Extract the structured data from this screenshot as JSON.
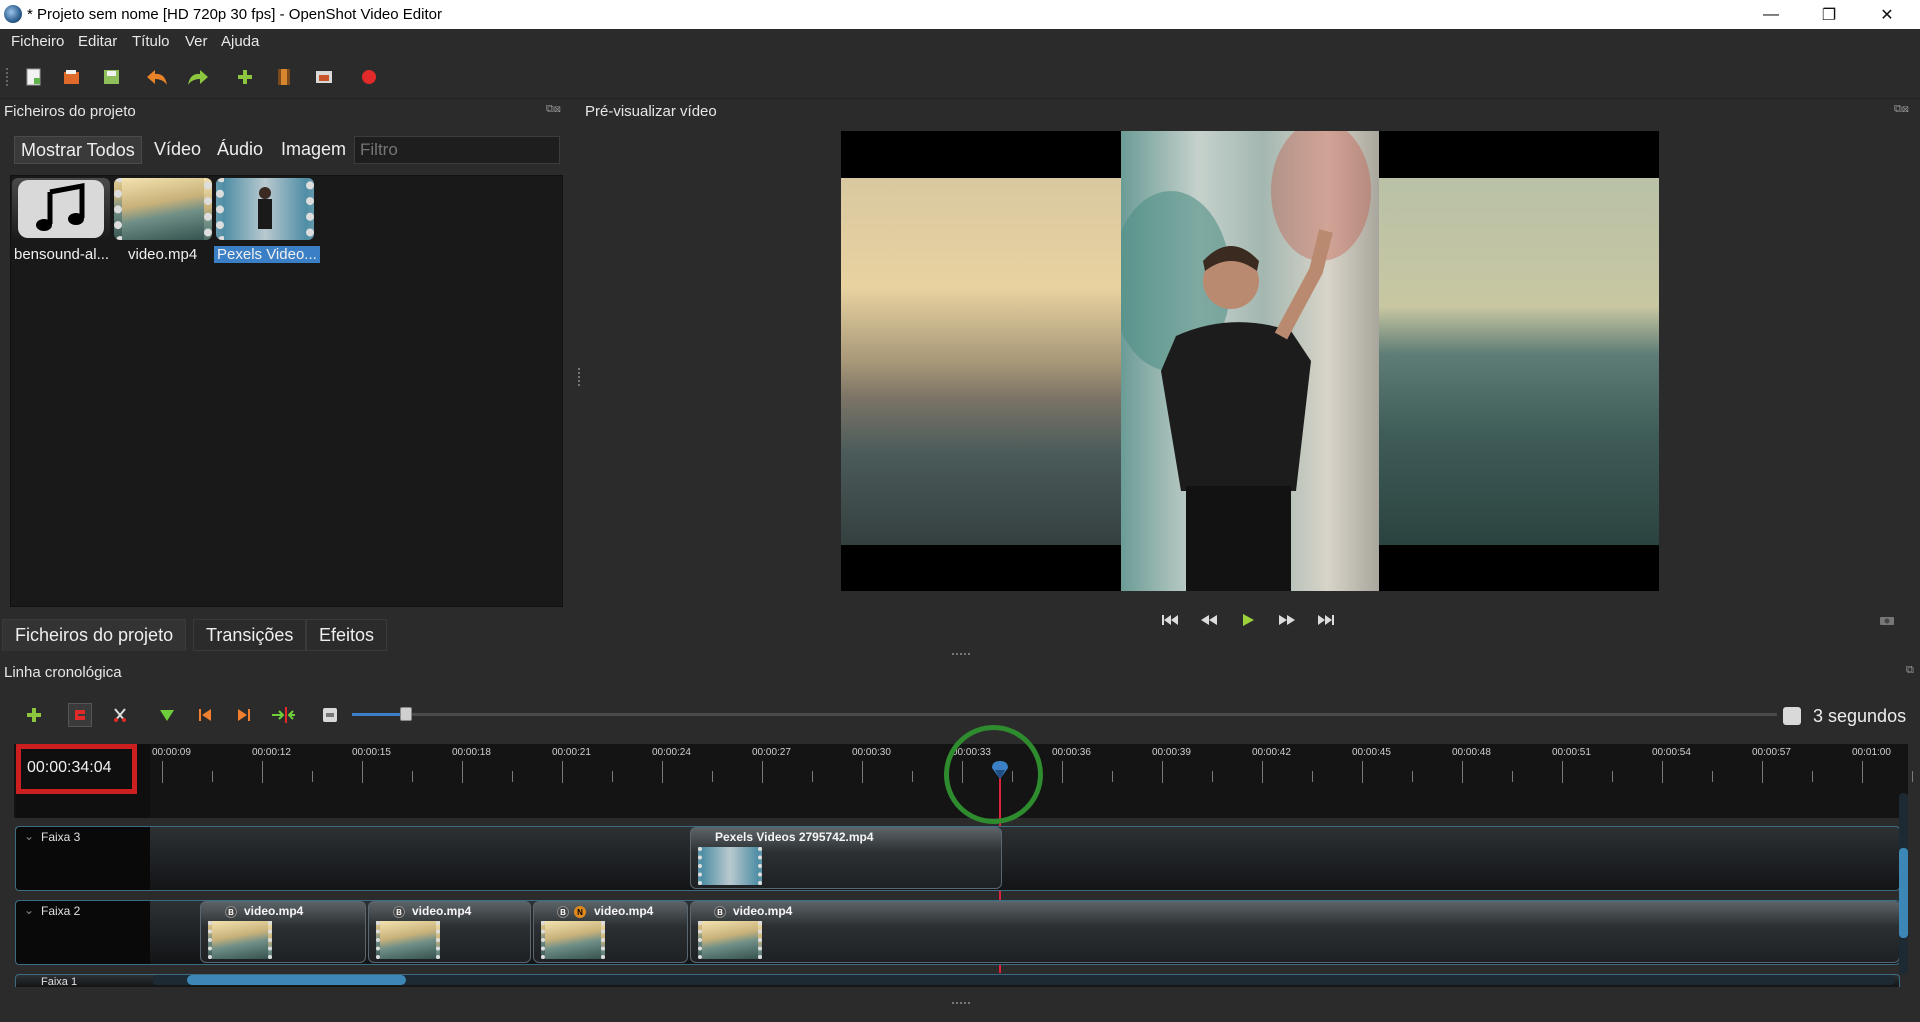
{
  "window": {
    "title": "* Projeto sem nome [HD 720p 30 fps] - OpenShot Video Editor",
    "controls": {
      "minimize": "—",
      "maximize": "❐",
      "close": "✕"
    }
  },
  "menu": [
    "Ficheiro",
    "Editar",
    "Título",
    "Ver",
    "Ajuda"
  ],
  "toolbar": {
    "icons": [
      "new-project-icon",
      "open-project-icon",
      "save-project-icon",
      "undo-icon",
      "redo-icon",
      "import-files-icon",
      "profile-icon",
      "fullscreen-icon",
      "export-video-icon"
    ]
  },
  "project_files": {
    "title": "Ficheiros do projeto",
    "filters": [
      "Mostrar Todos",
      "Vídeo",
      "Áudio",
      "Imagem"
    ],
    "filter_placeholder": "Filtro",
    "files": [
      {
        "label": "bensound-al...",
        "type": "audio"
      },
      {
        "label": "video.mp4",
        "type": "video"
      },
      {
        "label": "Pexels Video...",
        "type": "video",
        "selected": true
      }
    ],
    "tabs": [
      "Ficheiros do projeto",
      "Transições",
      "Efeitos"
    ]
  },
  "preview": {
    "title": "Pré-visualizar vídeo",
    "controls": [
      "jump-start-icon",
      "rewind-icon",
      "play-icon",
      "fast-forward-icon",
      "jump-end-icon"
    ]
  },
  "timeline": {
    "title": "Linha cronológica",
    "scale_label": "3 segundos",
    "current_time": "00:00:34:04",
    "ruler_labels": [
      "00:00:09",
      "00:00:12",
      "00:00:15",
      "00:00:18",
      "00:00:21",
      "00:00:24",
      "00:00:27",
      "00:00:30",
      "00:00:33",
      "00:00:36",
      "00:00:39",
      "00:00:42",
      "00:00:45",
      "00:00:48",
      "00:00:51",
      "00:00:54",
      "00:00:57",
      "00:01:00"
    ],
    "tracks": [
      {
        "name": "Faixa 3",
        "clips": [
          {
            "name": "Pexels Videos 2795742.mp4"
          }
        ]
      },
      {
        "name": "Faixa 2",
        "clips": [
          {
            "name": "video.mp4",
            "tags": [
              "B"
            ]
          },
          {
            "name": "video.mp4",
            "tags": [
              "B"
            ]
          },
          {
            "name": "video.mp4",
            "tags": [
              "B",
              "N"
            ]
          },
          {
            "name": "video.mp4",
            "tags": [
              "B"
            ]
          }
        ]
      },
      {
        "name": "Faixa 1",
        "clips": []
      }
    ]
  },
  "colors": {
    "background": "#2b2b2b",
    "accent_blue": "#3b80c6",
    "highlight_red": "#cc1f1f",
    "highlight_green": "#2e8b2e",
    "playhead": "#d9233b"
  }
}
